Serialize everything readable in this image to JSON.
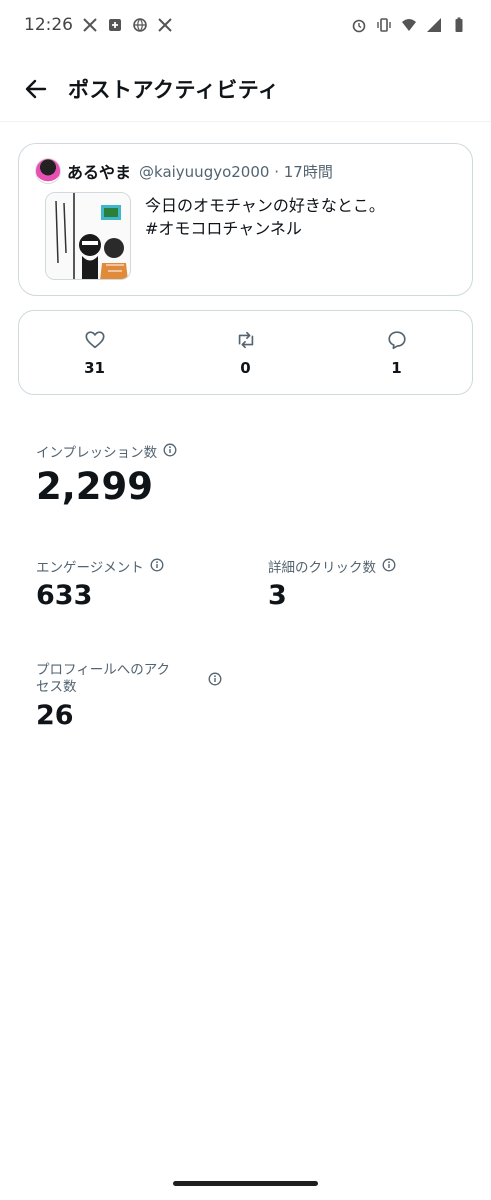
{
  "status_bar": {
    "time": "12:26",
    "left_icons": [
      "x-logo-icon",
      "plus-box-icon",
      "globe-icon",
      "x-logo-icon"
    ],
    "right_icons": [
      "alarm-icon",
      "vibrate-icon",
      "wifi-icon",
      "signal-icon",
      "battery-icon"
    ]
  },
  "header": {
    "title": "ポストアクティビティ"
  },
  "post": {
    "author_name": "あるやま",
    "handle_time": "@kaiyuugyo2000 · 17時間",
    "text_line1": "今日のオモチャンの好きなとこ。",
    "text_line2": "#オモコロチャンネル"
  },
  "engagement": {
    "likes": "31",
    "reposts": "0",
    "replies": "1"
  },
  "metrics": {
    "impressions_label": "インプレッション数",
    "impressions_value": "2,299",
    "engagements_label": "エンゲージメント",
    "engagements_value": "633",
    "detail_clicks_label": "詳細のクリック数",
    "detail_clicks_value": "3",
    "profile_visits_label_line1": "プロフィールへのアク",
    "profile_visits_label_line2": "セス数",
    "profile_visits_value": "26"
  }
}
